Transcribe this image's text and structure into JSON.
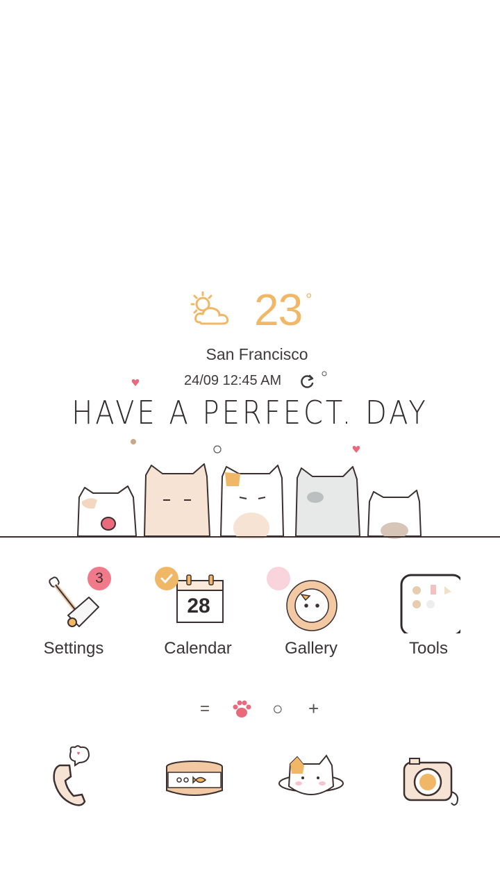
{
  "weather": {
    "icon": "partly-cloudy-icon",
    "temperature": "23",
    "degree_symbol": "°",
    "city": "San Francisco",
    "datetime": "24/09 12:45 AM"
  },
  "slogan": "HAVE A PERFECT. DAY",
  "apps": [
    {
      "label": "Settings",
      "icon": "lint-roller-icon",
      "badge": "3"
    },
    {
      "label": "Calendar",
      "icon": "calendar-icon",
      "date": "28"
    },
    {
      "label": "Gallery",
      "icon": "flower-cat-icon"
    },
    {
      "label": "Tools",
      "icon": "folder-icon"
    }
  ],
  "pager": {
    "items": [
      "menu-lines-icon",
      "paw-icon",
      "circle-icon",
      "plus-icon"
    ],
    "labels": [
      "=",
      "○",
      "+"
    ]
  },
  "dock": [
    {
      "icon": "phone-icon"
    },
    {
      "icon": "cat-food-can-icon"
    },
    {
      "icon": "cat-planet-icon"
    },
    {
      "icon": "camera-icon"
    }
  ],
  "colors": {
    "accent": "#f0b866",
    "badge_red": "#f0798a",
    "badge_orange": "#f0b866",
    "badge_pink": "#f9d4dc",
    "ground": "#3b2f2f"
  }
}
